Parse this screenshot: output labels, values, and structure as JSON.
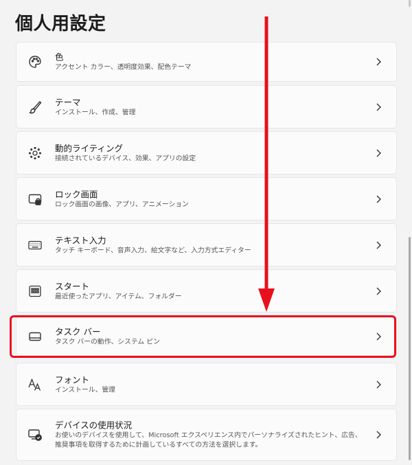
{
  "page": {
    "title": "個人用設定"
  },
  "items": [
    {
      "title": "色",
      "subtitle": "アクセント カラー、透明度効果、配色テーマ",
      "icon": "palette-icon"
    },
    {
      "title": "テーマ",
      "subtitle": "インストール、作成、管理",
      "icon": "brush-icon"
    },
    {
      "title": "動的ライティング",
      "subtitle": "接続されているデバイス、効果、アプリの設定",
      "icon": "lighting-icon"
    },
    {
      "title": "ロック画面",
      "subtitle": "ロック画面の画像、アプリ、アニメーション",
      "icon": "lock-screen-icon"
    },
    {
      "title": "テキスト入力",
      "subtitle": "タッチ キーボード、音声入力、絵文字など、入力方式エディター",
      "icon": "keyboard-icon"
    },
    {
      "title": "スタート",
      "subtitle": "最近使ったアプリ、アイテム、フォルダー",
      "icon": "start-icon"
    },
    {
      "title": "タスク バー",
      "subtitle": "タスク バーの動作、システム ピン",
      "icon": "taskbar-icon"
    },
    {
      "title": "フォント",
      "subtitle": "インストール、管理",
      "icon": "font-icon"
    },
    {
      "title": "デバイスの使用状況",
      "subtitle": "お使いのデバイスを使用して、Microsoft エクスペリエンス内でパーソナライズされたヒント、広告、推奨事項を取得するために計画しているすべての方法を選択します。",
      "icon": "device-usage-icon"
    }
  ],
  "colors": {
    "highlight": "#e8101c",
    "arrow": "#e8101c",
    "background": "#f3f3f3",
    "card": "#fbfbfb"
  }
}
